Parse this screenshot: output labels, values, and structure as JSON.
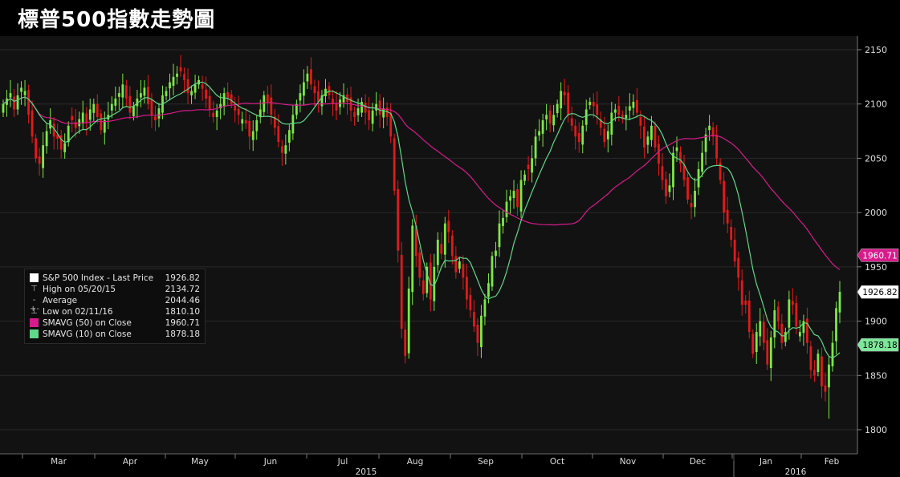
{
  "page_title": "標普500指數走勢圖",
  "chart_data": {
    "type": "candlestick",
    "title": "標普500指數走勢圖",
    "y_ticks": [
      2150,
      2100,
      2050,
      2000,
      1950,
      1900,
      1850,
      1800
    ],
    "ylim": [
      1780,
      2162
    ],
    "month_labels": [
      "Mar",
      "Apr",
      "May",
      "Jun",
      "Jul",
      "Aug",
      "Sep",
      "Oct",
      "Nov",
      "Dec",
      "Jan",
      "Feb"
    ],
    "year_labels": [
      "2015",
      "2016"
    ],
    "last_price_label": "1926.82",
    "sma50_label": "1960.71",
    "sma10_label": "1878.18",
    "colors": {
      "up": "#7ee846",
      "down": "#e01a1a",
      "sma50": "#d81b8c",
      "sma10": "#5fd88a",
      "grid": "#2a2a2a"
    },
    "close_series": [
      2100,
      2105,
      2110,
      2095,
      2108,
      2115,
      2112,
      2090,
      2070,
      2050,
      2045,
      2062,
      2075,
      2085,
      2070,
      2068,
      2058,
      2064,
      2080,
      2085,
      2078,
      2086,
      2092,
      2083,
      2095,
      2100,
      2088,
      2076,
      2085,
      2090,
      2100,
      2105,
      2110,
      2118,
      2105,
      2092,
      2098,
      2105,
      2110,
      2115,
      2100,
      2090,
      2085,
      2096,
      2108,
      2112,
      2120,
      2125,
      2128,
      2130,
      2122,
      2110,
      2112,
      2118,
      2122,
      2114,
      2105,
      2095,
      2088,
      2094,
      2100,
      2110,
      2105,
      2100,
      2094,
      2090,
      2086,
      2082,
      2070,
      2075,
      2085,
      2095,
      2108,
      2102,
      2090,
      2078,
      2065,
      2055,
      2062,
      2076,
      2090,
      2100,
      2110,
      2120,
      2128,
      2118,
      2110,
      2102,
      2108,
      2114,
      2108,
      2100,
      2094,
      2104,
      2108,
      2102,
      2094,
      2088,
      2096,
      2102,
      2092,
      2085,
      2094,
      2100,
      2090,
      2096,
      2088,
      2070,
      2020,
      1965,
      1893,
      1868,
      1930,
      1988,
      1960,
      1940,
      1925,
      1950,
      1920,
      1950,
      1975,
      1962,
      1990,
      1982,
      1960,
      1945,
      1955,
      1940,
      1920,
      1910,
      1895,
      1880,
      1905,
      1920,
      1935,
      1960,
      1965,
      1990,
      1995,
      2010,
      2015,
      2020,
      2005,
      2030,
      2035,
      2040,
      2050,
      2070,
      2075,
      2085,
      2090,
      2082,
      2090,
      2100,
      2112,
      2108,
      2090,
      2080,
      2070,
      2065,
      2080,
      2095,
      2102,
      2098,
      2090,
      2078,
      2065,
      2075,
      2092,
      2095,
      2090,
      2086,
      2090,
      2098,
      2102,
      2092,
      2080,
      2060,
      2070,
      2080,
      2060,
      2045,
      2030,
      2015,
      2025,
      2055,
      2060,
      2045,
      2030,
      2012,
      2005,
      2020,
      2040,
      2055,
      2072,
      2080,
      2070,
      2050,
      2030,
      2000,
      1990,
      1975,
      1955,
      1940,
      1915,
      1915,
      1890,
      1870,
      1890,
      1900,
      1880,
      1860,
      1885,
      1910,
      1900,
      1880,
      1890,
      1920,
      1915,
      1895,
      1890,
      1900,
      1880,
      1855,
      1850,
      1870,
      1840,
      1835,
      1860,
      1880,
      1912,
      1927
    ]
  },
  "legend": [
    {
      "marker": "box",
      "label": "S&P 500 Index - Last Price",
      "value": "1926.82",
      "color": "#ffffff"
    },
    {
      "marker": "T",
      "label": "High on 05/20/15",
      "value": "2134.72",
      "color": ""
    },
    {
      "marker": "avg",
      "label": "Average",
      "value": "2044.46",
      "color": ""
    },
    {
      "marker": "L",
      "label": "Low on 02/11/16",
      "value": "1810.10",
      "color": ""
    },
    {
      "marker": "box",
      "label": "SMAVG (50) on Close",
      "value": "1960.71",
      "color": "#d81b8c"
    },
    {
      "marker": "box",
      "label": "SMAVG (10) on Close",
      "value": "1878.18",
      "color": "#5fd88a"
    }
  ]
}
